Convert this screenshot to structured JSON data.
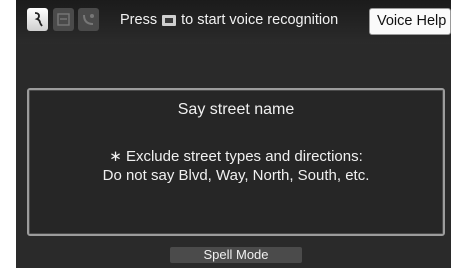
{
  "header": {
    "mode_icons": [
      {
        "name": "voice-command-icon",
        "state": "active"
      },
      {
        "name": "voice-portal-icon",
        "state": "inactive"
      },
      {
        "name": "voice-phone-icon",
        "state": "inactive"
      }
    ],
    "prompt_before": "Press",
    "prompt_icon": "talk-button-icon",
    "prompt_after": "to start voice recognition",
    "voice_help_label": "Voice Help"
  },
  "message": {
    "title": "Say street name",
    "note_line1": "∗ Exclude street types and directions:",
    "note_line2": "Do not say Blvd, Way, North, South, etc."
  },
  "footer": {
    "spell_mode_label": "Spell Mode"
  },
  "colors": {
    "background": "#2a2a2a",
    "panel_border": "#9c9c9c",
    "text": "#f0f0f0",
    "button_face": "#fafafa"
  }
}
